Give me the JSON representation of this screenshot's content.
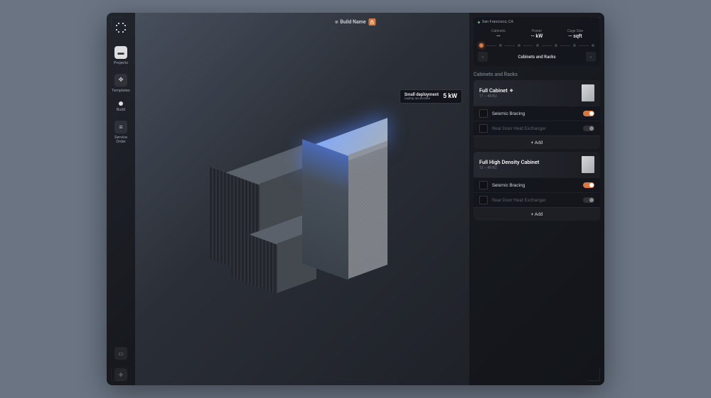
{
  "header": {
    "build_name": "Build Name"
  },
  "sidebar": {
    "items": [
      {
        "label": "Projects"
      },
      {
        "label": "Templates"
      },
      {
        "label": "Build"
      },
      {
        "label": "Service Order"
      }
    ]
  },
  "tooltip": {
    "title": "Small deployment",
    "subtitle": "Laptop accessible",
    "value": "5 kW"
  },
  "summary": {
    "location": "San Francisco, CA",
    "metrics": [
      {
        "label": "Cabinets",
        "value": "--"
      },
      {
        "label": "Power",
        "value": "-- kW"
      },
      {
        "label": "Cage Size",
        "value": "-- sqft"
      }
    ],
    "stage_label": "Cabinets and Racks"
  },
  "section_title": "Cabinets and Racks",
  "cards": [
    {
      "title": "Full Cabinet",
      "subtitle": "17 – 48 RU",
      "options": [
        {
          "label": "Seismic Bracing",
          "on": true
        },
        {
          "label": "Rear Door Heat Exchanger",
          "on": false
        }
      ],
      "add_label": "+   Add"
    },
    {
      "title": "Full High Density Cabinet",
      "subtitle": "12 – 48 RU",
      "options": [
        {
          "label": "Seismic Bracing",
          "on": true
        },
        {
          "label": "Rear Door Heat Exchanger",
          "on": false
        }
      ],
      "add_label": "+   Add"
    }
  ]
}
